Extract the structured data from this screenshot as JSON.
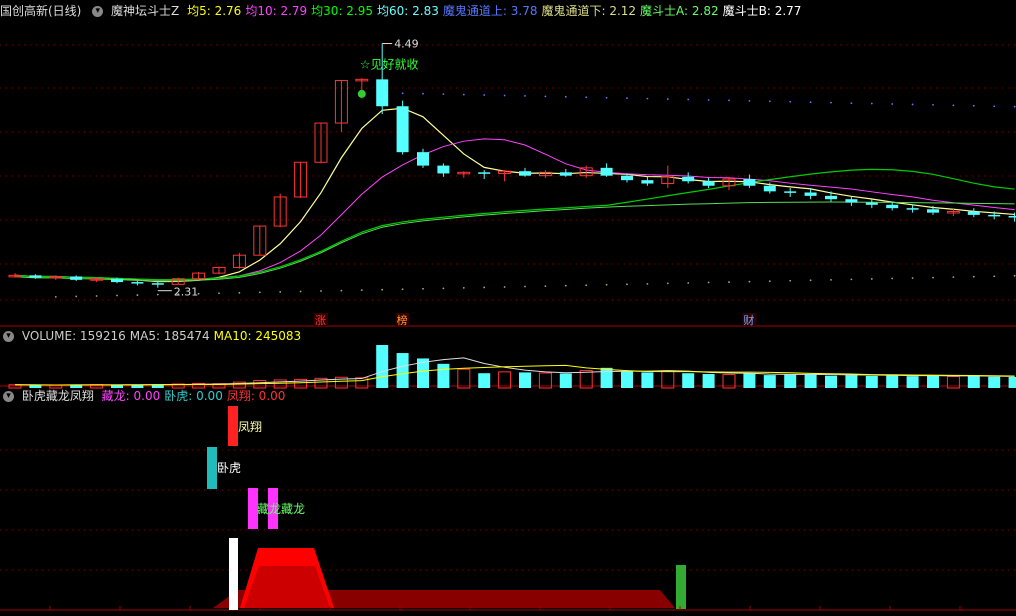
{
  "header_main": {
    "stock_name": "国创高新(日线)",
    "indicator": "魔神坛斗士Z",
    "items": [
      {
        "label": "均5:",
        "value": "2.76",
        "color": "#ffff00"
      },
      {
        "label": "均10:",
        "value": "2.79",
        "color": "#ff44ff"
      },
      {
        "label": "均30:",
        "value": "2.95",
        "color": "#00ff00"
      },
      {
        "label": "均60:",
        "value": "2.83",
        "color": "#66ffff"
      },
      {
        "label": "魔鬼通道上:",
        "value": "3.78",
        "color": "#5577ff"
      },
      {
        "label": "魔鬼通道下:",
        "value": "2.12",
        "color": "#dddd88"
      },
      {
        "label": "魔斗士A:",
        "value": "2.82",
        "color": "#66ff66"
      },
      {
        "label": "魔斗士B:",
        "value": "2.77",
        "color": "#ffffff"
      }
    ]
  },
  "header_volume": {
    "items": [
      {
        "label": "VOLUME:",
        "value": "159216",
        "color": "#cccccc"
      },
      {
        "label": "MA5:",
        "value": "185474",
        "color": "#cccccc"
      },
      {
        "label": "MA10:",
        "value": "245083",
        "color": "#ffff00"
      }
    ]
  },
  "header_ind": {
    "name": "卧虎藏龙凤翔",
    "items": [
      {
        "label": "藏龙:",
        "value": "0.00",
        "color": "#ff44ff"
      },
      {
        "label": "卧虎:",
        "value": "0.00",
        "color": "#33cccc"
      },
      {
        "label": "凤翔:",
        "value": "0.00",
        "color": "#ff3333"
      }
    ]
  },
  "annotations": {
    "high": "4.49",
    "low": "2.31",
    "signal": "☆见好就收",
    "tags": [
      "涨",
      "榜",
      "财"
    ],
    "fengxiang": "凤翔",
    "wohu": "卧虎",
    "canglong": "藏龙藏龙"
  },
  "colors": {
    "up": "#ff3333",
    "down": "#55ffff",
    "bg": "#000000",
    "grid": "#880000"
  },
  "chart_data": {
    "type": "candlestick",
    "title": "国创高新(日线)",
    "ohlc": [
      [
        2.42,
        2.44,
        2.4,
        2.42
      ],
      [
        2.42,
        2.43,
        2.39,
        2.4
      ],
      [
        2.4,
        2.42,
        2.38,
        2.41
      ],
      [
        2.41,
        2.42,
        2.37,
        2.38
      ],
      [
        2.38,
        2.4,
        2.36,
        2.39
      ],
      [
        2.39,
        2.4,
        2.35,
        2.36
      ],
      [
        2.36,
        2.37,
        2.33,
        2.35
      ],
      [
        2.35,
        2.36,
        2.31,
        2.34
      ],
      [
        2.34,
        2.4,
        2.34,
        2.39
      ],
      [
        2.39,
        2.45,
        2.38,
        2.44
      ],
      [
        2.44,
        2.5,
        2.43,
        2.49
      ],
      [
        2.49,
        2.62,
        2.48,
        2.6
      ],
      [
        2.6,
        2.86,
        2.6,
        2.86
      ],
      [
        2.86,
        3.15,
        2.85,
        3.12
      ],
      [
        3.12,
        3.43,
        3.11,
        3.43
      ],
      [
        3.43,
        3.78,
        3.42,
        3.78
      ],
      [
        3.78,
        4.16,
        3.7,
        4.16
      ],
      [
        4.16,
        4.18,
        4.0,
        4.17
      ],
      [
        4.17,
        4.49,
        3.86,
        3.93
      ],
      [
        3.93,
        3.98,
        3.5,
        3.52
      ],
      [
        3.52,
        3.55,
        3.38,
        3.4
      ],
      [
        3.4,
        3.42,
        3.3,
        3.33
      ],
      [
        3.33,
        3.35,
        3.29,
        3.34
      ],
      [
        3.34,
        3.36,
        3.28,
        3.33
      ],
      [
        3.33,
        3.36,
        3.26,
        3.35
      ],
      [
        3.35,
        3.38,
        3.3,
        3.31
      ],
      [
        3.31,
        3.36,
        3.29,
        3.34
      ],
      [
        3.34,
        3.37,
        3.3,
        3.31
      ],
      [
        3.31,
        3.4,
        3.29,
        3.38
      ],
      [
        3.38,
        3.42,
        3.3,
        3.31
      ],
      [
        3.31,
        3.33,
        3.25,
        3.27
      ],
      [
        3.27,
        3.3,
        3.22,
        3.24
      ],
      [
        3.24,
        3.4,
        3.2,
        3.3
      ],
      [
        3.3,
        3.34,
        3.24,
        3.26
      ],
      [
        3.26,
        3.29,
        3.2,
        3.22
      ],
      [
        3.22,
        3.3,
        3.18,
        3.28
      ],
      [
        3.28,
        3.32,
        3.2,
        3.22
      ],
      [
        3.22,
        3.25,
        3.15,
        3.17
      ],
      [
        3.17,
        3.2,
        3.12,
        3.16
      ],
      [
        3.16,
        3.2,
        3.1,
        3.13
      ],
      [
        3.13,
        3.17,
        3.08,
        3.1
      ],
      [
        3.1,
        3.12,
        3.04,
        3.07
      ],
      [
        3.07,
        3.1,
        3.02,
        3.05
      ],
      [
        3.05,
        3.08,
        3.0,
        3.02
      ],
      [
        3.02,
        3.05,
        2.98,
        3.01
      ],
      [
        3.01,
        3.04,
        2.96,
        2.98
      ],
      [
        2.98,
        3.02,
        2.95,
        2.99
      ],
      [
        2.99,
        3.02,
        2.94,
        2.96
      ],
      [
        2.96,
        2.99,
        2.92,
        2.95
      ],
      [
        2.95,
        2.98,
        2.9,
        2.94
      ]
    ],
    "volume": [
      12000,
      11000,
      10500,
      13000,
      12500,
      11800,
      12200,
      13500,
      15000,
      17000,
      16000,
      22000,
      28000,
      30000,
      32000,
      36000,
      40000,
      38000,
      160000,
      130000,
      110000,
      90000,
      70000,
      55000,
      60000,
      58000,
      56000,
      54000,
      65000,
      75000,
      62000,
      58000,
      64000,
      55000,
      52000,
      50000,
      54000,
      48000,
      50000,
      52000,
      46000,
      48000,
      45000,
      47000,
      44000,
      46000,
      43000,
      45000,
      42000,
      41000
    ],
    "series": [
      {
        "name": "均5"
      },
      {
        "name": "均10"
      },
      {
        "name": "均30"
      },
      {
        "name": "均60"
      },
      {
        "name": "魔鬼通道上"
      },
      {
        "name": "魔鬼通道下"
      },
      {
        "name": "魔斗士A"
      },
      {
        "name": "魔斗士B"
      }
    ],
    "y_range": [
      2.2,
      4.7
    ]
  }
}
